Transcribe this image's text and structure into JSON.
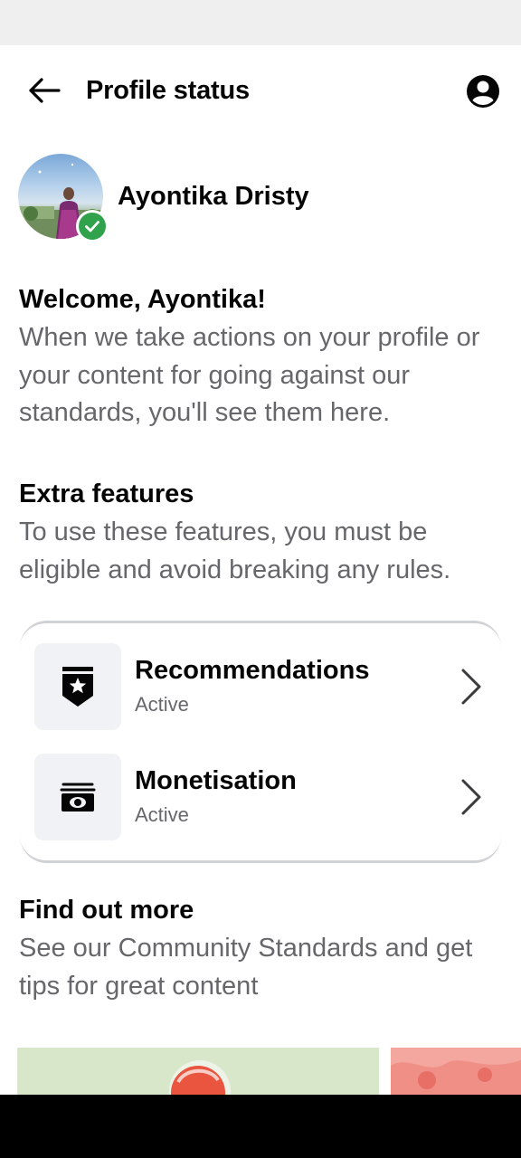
{
  "header": {
    "title": "Profile status"
  },
  "profile": {
    "name": "Ayontika Dristy",
    "verified": true
  },
  "welcome": {
    "heading": "Welcome, Ayontika!",
    "body": "When we take actions on your profile or your content for going against our standards, you'll see them here."
  },
  "extra_features": {
    "heading": "Extra features",
    "body": "To use these features, you must be eligible and avoid breaking any rules.",
    "items": [
      {
        "name": "Recommendations",
        "status": "Active",
        "icon": "shield-star-icon"
      },
      {
        "name": "Monetisation",
        "status": "Active",
        "icon": "money-icon"
      }
    ]
  },
  "find_out_more": {
    "heading": "Find out more",
    "body": "See our Community Standards and get tips for great content"
  },
  "colors": {
    "status_success": "#31a24c",
    "text_secondary": "#65676b",
    "icon_tile_bg": "#f0f2f5"
  }
}
